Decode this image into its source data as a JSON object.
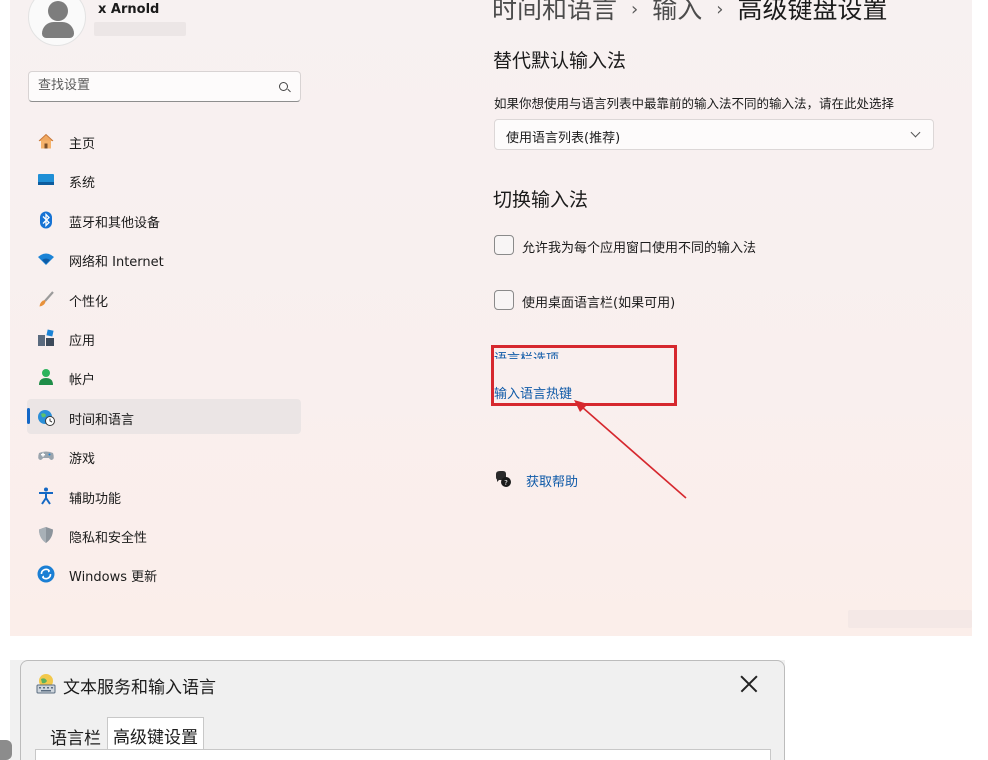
{
  "user": {
    "name": "x Arnold"
  },
  "search": {
    "placeholder": "查找设置"
  },
  "nav": {
    "items": [
      {
        "label": "主页",
        "icon": "home-icon"
      },
      {
        "label": "系统",
        "icon": "display-icon"
      },
      {
        "label": "蓝牙和其他设备",
        "icon": "bluetooth-icon"
      },
      {
        "label": "网络和 Internet",
        "icon": "wifi-icon"
      },
      {
        "label": "个性化",
        "icon": "paintbrush-icon"
      },
      {
        "label": "应用",
        "icon": "apps-icon"
      },
      {
        "label": "帐户",
        "icon": "person-icon"
      },
      {
        "label": "时间和语言",
        "icon": "globe-clock-icon",
        "active": true
      },
      {
        "label": "游戏",
        "icon": "gamepad-icon"
      },
      {
        "label": "辅助功能",
        "icon": "accessibility-icon"
      },
      {
        "label": "隐私和安全性",
        "icon": "shield-icon"
      },
      {
        "label": "Windows 更新",
        "icon": "update-icon"
      }
    ]
  },
  "breadcrumb": {
    "part1": "时间和语言",
    "part2": "输入",
    "current": "高级键盘设置"
  },
  "override": {
    "heading": "替代默认输入法",
    "description": "如果你想使用与语言列表中最靠前的输入法不同的输入法，请在此处选择",
    "dropdown_value": "使用语言列表(推荐)"
  },
  "switching": {
    "heading": "切换输入法",
    "checkbox1": "允许我为每个应用窗口使用不同的输入法",
    "checkbox2": "使用桌面语言栏(如果可用)",
    "link_language_bar": "语言栏选项",
    "link_hotkeys": "输入语言热键"
  },
  "help": {
    "label": "获取帮助"
  },
  "dialog": {
    "title": "文本服务和输入语言",
    "tab1": "语言栏",
    "tab2": "高级键设置"
  },
  "colors": {
    "accent": "#1467c6",
    "link": "#0f5aa8",
    "highlight": "#d6282e"
  }
}
